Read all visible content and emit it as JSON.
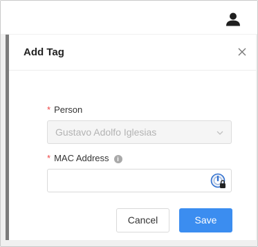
{
  "modal": {
    "title": "Add Tag",
    "fields": {
      "person": {
        "label": "Person",
        "required_marker": "*",
        "value": "Gustavo Adolfo Iglesias"
      },
      "mac_address": {
        "label": "MAC Address",
        "required_marker": "*",
        "info_glyph": "i",
        "value": "",
        "placeholder": ""
      }
    },
    "buttons": {
      "cancel": "Cancel",
      "save": "Save"
    }
  },
  "icons": {
    "user": "user-icon",
    "close": "close-icon",
    "chevron": "chevron-down-icon",
    "info": "info-icon",
    "password_manager": "password-manager-icon"
  },
  "colors": {
    "primary": "#3b8df0",
    "required": "#e44444",
    "modal_accent_border": "#7c7c7c"
  }
}
